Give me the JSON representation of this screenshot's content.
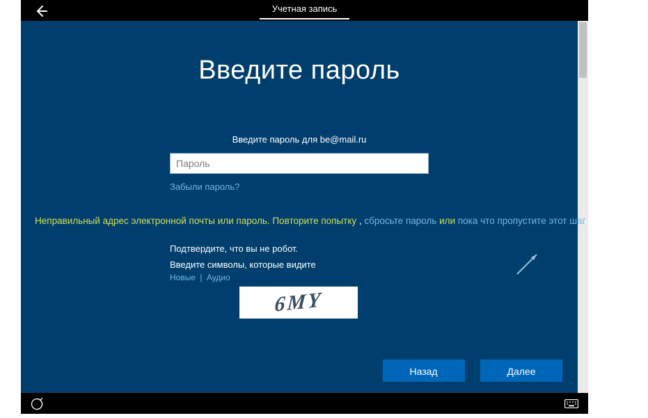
{
  "header": {
    "tab_label": "Учетная запись"
  },
  "main": {
    "title": "Введите пароль",
    "instruction": "Введите пароль для be@mail.ru",
    "password_placeholder": "Пароль",
    "forgot_link": "Забыли пароль?"
  },
  "error": {
    "part1": "Неправильный адрес электронной почты или пароль. Повторите попытку",
    "comma": " , ",
    "reset_link": "сбросьте пароль",
    "or": " или ",
    "skip_link": "пока что пропустите этот шаг",
    "period": "."
  },
  "captcha": {
    "confirm_label": "Подтвердите, что вы не робот.",
    "enter_label": "Введите символы, которые видите",
    "new_link": "Новые",
    "audio_link": "Аудио",
    "image_text": "6MY"
  },
  "buttons": {
    "back": "Назад",
    "next": "Далее"
  }
}
